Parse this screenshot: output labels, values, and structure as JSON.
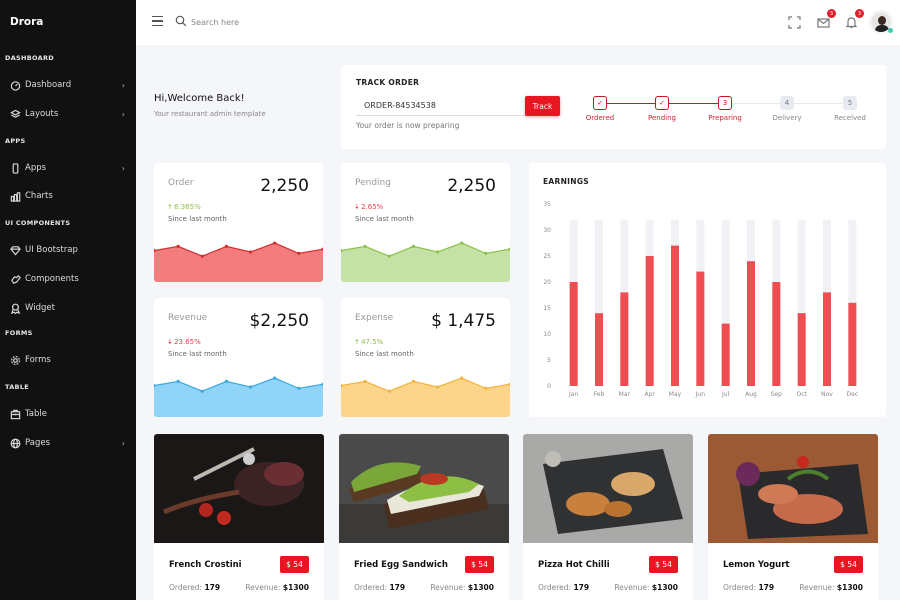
{
  "sidebar": {
    "brand": "Drora",
    "sections": [
      {
        "title": "DASHBOARD",
        "items": [
          {
            "label": "Dashboard",
            "icon": "speedometer-icon",
            "has_submenu": true
          },
          {
            "label": "Layouts",
            "icon": "layers-icon",
            "has_submenu": true
          }
        ]
      },
      {
        "title": "APPS",
        "items": [
          {
            "label": "Apps",
            "icon": "mobile-icon",
            "has_submenu": true
          },
          {
            "label": "Charts",
            "icon": "bar-chart-icon",
            "has_submenu": false
          }
        ]
      },
      {
        "title": "UI COMPONENTS",
        "items": [
          {
            "label": "UI Bootstrap",
            "icon": "diamond-icon",
            "has_submenu": false
          },
          {
            "label": "Components",
            "icon": "hand-icon",
            "has_submenu": false
          },
          {
            "label": "Widget",
            "icon": "award-icon",
            "has_submenu": false
          }
        ]
      },
      {
        "title": "FORMS",
        "items": [
          {
            "label": "Forms",
            "icon": "gear-icon",
            "has_submenu": false
          }
        ]
      },
      {
        "title": "TABLE",
        "items": [
          {
            "label": "Table",
            "icon": "table-icon",
            "has_submenu": false
          },
          {
            "label": "Pages",
            "icon": "globe-icon",
            "has_submenu": true
          }
        ]
      }
    ]
  },
  "header": {
    "search_placeholder": "Search here",
    "mail_badge": "3",
    "notification_badge": "3"
  },
  "welcome": {
    "title": "Hi,Welcome Back!",
    "subtitle": "Your restaurant admin template"
  },
  "track_order": {
    "title": "TRACK ORDER",
    "input_value": "ORDER-84534538",
    "button_label": "Track",
    "status_text": "Your order is now preparing",
    "steps": [
      {
        "label": "Ordered",
        "marker": "✓",
        "state": "done"
      },
      {
        "label": "Pending",
        "marker": "✓",
        "state": "done"
      },
      {
        "label": "Preparing",
        "marker": "3",
        "state": "active"
      },
      {
        "label": "Delivery",
        "marker": "4",
        "state": "todo"
      },
      {
        "label": "Received",
        "marker": "5",
        "state": "todo"
      }
    ]
  },
  "stats": [
    {
      "label": "Order",
      "value": "2,250",
      "change": "6.365%",
      "direction": "up",
      "since": "Since last month",
      "color": "#f47c7c",
      "line": "#d32f2f"
    },
    {
      "label": "Pending",
      "value": "2,250",
      "change": "2.65%",
      "direction": "down",
      "since": "Since last month",
      "color": "#c5e1a5",
      "line": "#8bc34a"
    },
    {
      "label": "Revenue",
      "value": "$2,250",
      "change": "23.65%",
      "direction": "down",
      "since": "Since last month",
      "color": "#90d5f8",
      "line": "#3ba9e0"
    },
    {
      "label": "Expense",
      "value": "$ 1,475",
      "change": "47.5%",
      "direction": "up",
      "since": "Since last month",
      "color": "#fdd58a",
      "line": "#f4b23e"
    }
  ],
  "sparkline": [
    0.55,
    0.7,
    0.35,
    0.7,
    0.5,
    0.82,
    0.45,
    0.6
  ],
  "chart_data": {
    "type": "bar",
    "title": "EARNINGS",
    "categories": [
      "Jan",
      "Feb",
      "Mar",
      "Apr",
      "May",
      "Jun",
      "Jul",
      "Aug",
      "Sep",
      "Oct",
      "Nov",
      "Dec"
    ],
    "values": [
      20,
      14,
      18,
      25,
      27,
      22,
      12,
      24,
      20,
      14,
      18,
      16
    ],
    "background_max": 32,
    "ylim": [
      0,
      35
    ],
    "yticks": [
      0,
      5,
      10,
      15,
      20,
      25,
      30,
      35
    ],
    "xlabel": "",
    "ylabel": "",
    "bar_color": "#ef4d52",
    "track_color": "#f1f2f6",
    "grid": false
  },
  "foods": [
    {
      "name": "French Crostini",
      "price": "$ 54",
      "ordered_label": "Ordered:",
      "ordered": "179",
      "revenue_label": "Revenue:",
      "revenue": "$1300"
    },
    {
      "name": "Fried Egg Sandwich",
      "price": "$ 54",
      "ordered_label": "Ordered:",
      "ordered": "179",
      "revenue_label": "Revenue:",
      "revenue": "$1300"
    },
    {
      "name": "Pizza Hot Chilli",
      "price": "$ 54",
      "ordered_label": "Ordered:",
      "ordered": "179",
      "revenue_label": "Revenue:",
      "revenue": "$1300"
    },
    {
      "name": "Lemon Yogurt",
      "price": "$ 54",
      "ordered_label": "Ordered:",
      "ordered": "179",
      "revenue_label": "Revenue:",
      "revenue": "$1300"
    }
  ]
}
